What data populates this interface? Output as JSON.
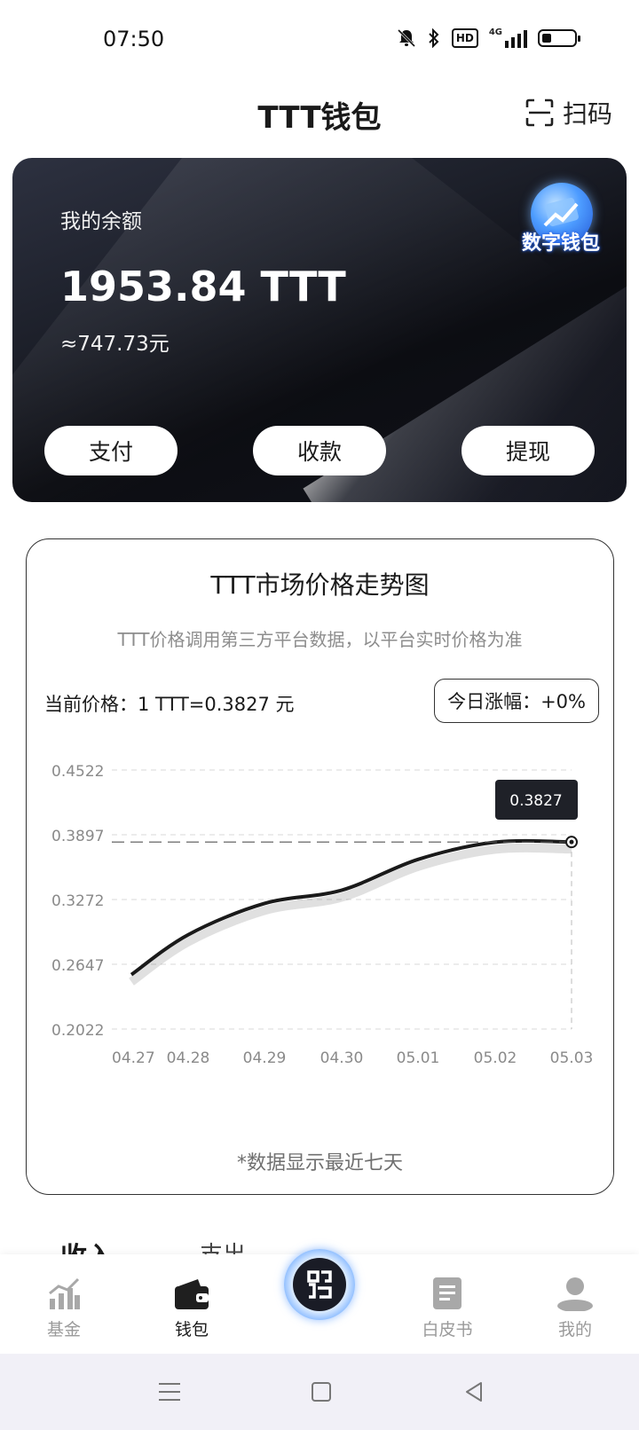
{
  "status_bar": {
    "time": "07:50",
    "hd": "HD",
    "network": "4G"
  },
  "header": {
    "title": "TTT钱包",
    "scan_label": "扫码"
  },
  "wallet": {
    "balance_label": "我的余额",
    "balance": "1953.84 TTT",
    "cny_value": "≈747.73元",
    "badge_text": "数字钱包",
    "actions": [
      "支付",
      "收款",
      "提现"
    ]
  },
  "chart_card": {
    "title": "TTT市场价格走势图",
    "subtitle": "TTT价格调用第三方平台数据，以平台实时价格为准",
    "current_price": "当前价格：1 TTT=0.3827 元",
    "today_change": "今日涨幅：+0%",
    "note": "*数据显示最近七天",
    "tooltip": "0.3827"
  },
  "chart_data": {
    "type": "line",
    "x": [
      "04.27",
      "04.28",
      "04.29",
      "04.30",
      "05.01",
      "05.02",
      "05.03"
    ],
    "series": [
      {
        "values": [
          0.2547,
          0.2932,
          0.3234,
          0.3362,
          0.3659,
          0.3825,
          0.3827
        ]
      }
    ],
    "yticks": [
      "0.4522",
      "0.3897",
      "0.3272",
      "0.2647",
      "0.2022"
    ],
    "ylim": [
      0.2022,
      0.4522
    ],
    "highlight_value": 0.3827,
    "grid": true
  },
  "partial_tabs": [
    "收入",
    "支出"
  ],
  "bottom_nav": {
    "items": [
      {
        "label": "基金",
        "active": false
      },
      {
        "label": "钱包",
        "active": true
      },
      {
        "label": "",
        "active": false
      },
      {
        "label": "白皮书",
        "active": false
      },
      {
        "label": "我的",
        "active": false
      }
    ]
  }
}
